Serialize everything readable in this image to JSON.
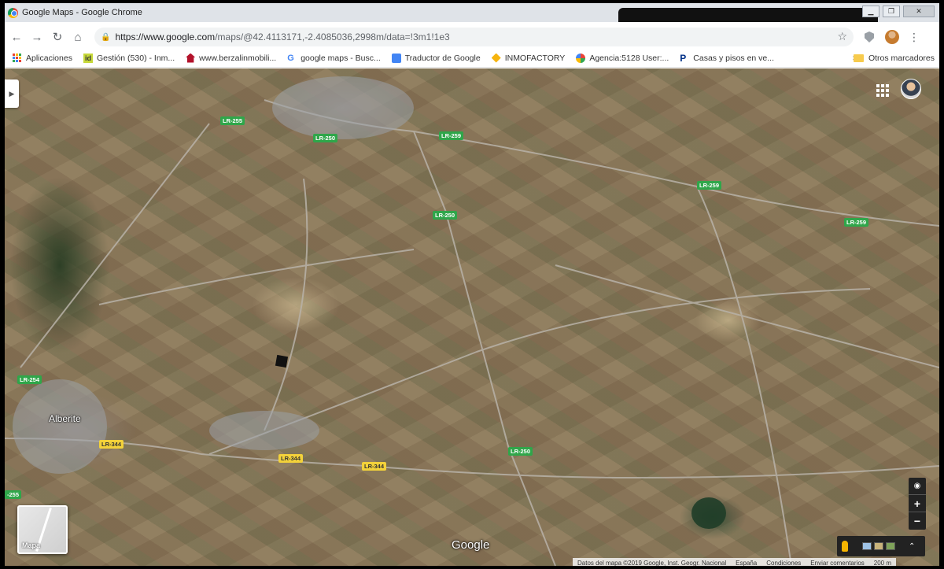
{
  "window": {
    "title": "Google Maps - Google Chrome"
  },
  "navbar": {
    "url_host": "https://www.google.com",
    "url_path": "/maps/@42.4113171,-2.4085036,2998m/data=!3m1!1e3"
  },
  "bookmarks": {
    "items": [
      {
        "label": "Aplicaciones",
        "icon": "apps-grid-icon"
      },
      {
        "label": "Gestión (530) - Inm...",
        "icon": "idealista-icon"
      },
      {
        "label": "www.berzalinmobili...",
        "icon": "house-icon"
      },
      {
        "label": "google maps - Busc...",
        "icon": "google-icon"
      },
      {
        "label": "Traductor de Google",
        "icon": "translate-icon"
      },
      {
        "label": "INMOFACTORY",
        "icon": "inmofactory-icon"
      },
      {
        "label": "Agencia:5128 User:...",
        "icon": "agency-icon"
      },
      {
        "label": "Casas y pisos en ve...",
        "icon": "paypal-icon"
      }
    ],
    "more": "»",
    "other_label": "Otros marcadores"
  },
  "map": {
    "roads": [
      {
        "label": "LR-255"
      },
      {
        "label": "LR-250"
      },
      {
        "label": "LR-259"
      },
      {
        "label": "LR-259"
      },
      {
        "label": "LR-259"
      },
      {
        "label": "LR-250"
      },
      {
        "label": "LR-254"
      },
      {
        "label": "LR-344"
      },
      {
        "label": "LR-344"
      },
      {
        "label": "LR-344"
      },
      {
        "label": "LR-250"
      },
      {
        "label": "-255"
      }
    ],
    "place": "Alberite",
    "minimap_label": "Mapa",
    "logo": "Google",
    "zoom_in": "+",
    "zoom_out": "−"
  },
  "footer": {
    "attribution": "Datos del mapa ©2019 Google, Inst. Geogr. Nacional",
    "country": "España",
    "terms": "Condiciones",
    "feedback": "Enviar comentarios",
    "scale": "200 m"
  }
}
